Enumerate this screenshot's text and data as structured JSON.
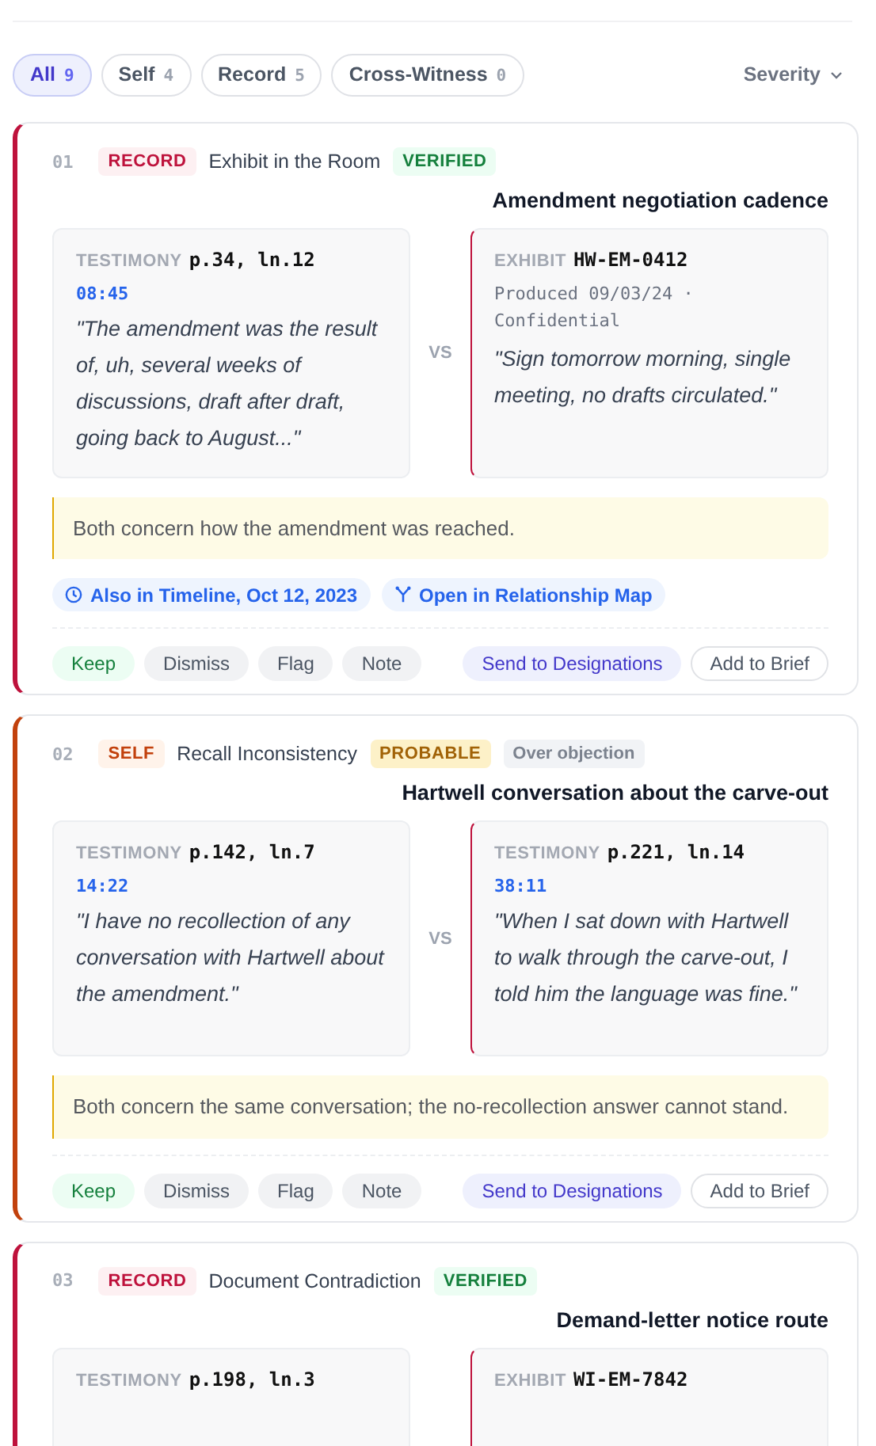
{
  "filters": [
    {
      "label": "All",
      "count": "9",
      "selected": true
    },
    {
      "label": "Self",
      "count": "4",
      "selected": false
    },
    {
      "label": "Record",
      "count": "5",
      "selected": false
    },
    {
      "label": "Cross-Witness",
      "count": "0",
      "selected": false
    }
  ],
  "sort": {
    "label": "Severity"
  },
  "cards": [
    {
      "number": "01",
      "category": {
        "label": "RECORD",
        "kind": "record"
      },
      "type": "Exhibit in the Room",
      "status": {
        "label": "VERIFIED",
        "kind": "verified"
      },
      "title": "Amendment negotiation cadence",
      "left": {
        "kind": "testimony",
        "label": "TESTIMONY",
        "ref": "p.34, ln.12",
        "time": "08:45",
        "quote": "\"The amendment was the result of, uh, several weeks of discussions, draft after draft, going back to August...\""
      },
      "vs": "VS",
      "right": {
        "kind": "exhibit",
        "label": "EXHIBIT",
        "ref": "HW-EM-0412",
        "meta": "Produced 09/03/24 · Confidential",
        "quote": "\"Sign tomorrow morning, single meeting, no drafts circulated.\""
      },
      "note": "Both concern how the amendment was reached.",
      "links": [
        {
          "kind": "timeline",
          "label": "Also in Timeline, Oct 12, 2023"
        },
        {
          "kind": "map",
          "label": "Open in Relationship Map"
        }
      ],
      "actions": [
        {
          "kind": "keep",
          "label": "Keep"
        },
        {
          "kind": "neutral",
          "label": "Dismiss"
        },
        {
          "kind": "neutral",
          "label": "Flag"
        },
        {
          "kind": "neutral",
          "label": "Note"
        },
        {
          "kind": "send",
          "label": "Send to Designations"
        },
        {
          "kind": "outline",
          "label": "Add to Brief"
        }
      ]
    },
    {
      "number": "02",
      "category": {
        "label": "SELF",
        "kind": "self"
      },
      "type": "Recall Inconsistency",
      "status": {
        "label": "PROBABLE",
        "kind": "probable"
      },
      "extra_tag": "Over objection",
      "title": "Hartwell conversation about the carve-out",
      "left": {
        "kind": "testimony",
        "label": "TESTIMONY",
        "ref": "p.142, ln.7",
        "time": "14:22",
        "quote": "\"I have no recollection of any conversation with Hartwell about the amendment.\""
      },
      "vs": "VS",
      "right": {
        "kind": "testimony",
        "label": "TESTIMONY",
        "ref": "p.221, ln.14",
        "time": "38:11",
        "quote": "\"When I sat down with Hartwell to walk through the carve-out, I told him the language was fine.\""
      },
      "note": "Both concern the same conversation; the no-recollection answer cannot stand.",
      "actions": [
        {
          "kind": "keep",
          "label": "Keep"
        },
        {
          "kind": "neutral",
          "label": "Dismiss"
        },
        {
          "kind": "neutral",
          "label": "Flag"
        },
        {
          "kind": "neutral",
          "label": "Note"
        },
        {
          "kind": "send",
          "label": "Send to Designations"
        },
        {
          "kind": "outline",
          "label": "Add to Brief"
        }
      ]
    },
    {
      "number": "03",
      "category": {
        "label": "RECORD",
        "kind": "record"
      },
      "type": "Document Contradiction",
      "status": {
        "label": "VERIFIED",
        "kind": "verified"
      },
      "title": "Demand-letter notice route",
      "left": {
        "kind": "testimony",
        "label": "TESTIMONY",
        "ref": "p.198, ln.3"
      },
      "right": {
        "kind": "exhibit",
        "label": "EXHIBIT",
        "ref": "WI-EM-7842"
      }
    }
  ]
}
